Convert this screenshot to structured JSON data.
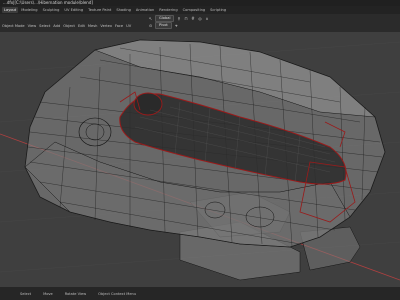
{
  "window": {
    "title": "...dfx|[C:\\Users\\...\\Hibernation module\\blend]"
  },
  "workspace_tabs": [
    {
      "label": "Layout",
      "active": true
    },
    {
      "label": "Modeling",
      "active": false
    },
    {
      "label": "Sculpting",
      "active": false
    },
    {
      "label": "UV Editing",
      "active": false
    },
    {
      "label": "Texture Paint",
      "active": false
    },
    {
      "label": "Shading",
      "active": false
    },
    {
      "label": "Animation",
      "active": false
    },
    {
      "label": "Rendering",
      "active": false
    },
    {
      "label": "Compositing",
      "active": false
    },
    {
      "label": "Scripting",
      "active": false
    }
  ],
  "toolbar": {
    "orientation": "Global",
    "snap_mode": "Pivot",
    "header_menus": [
      "Object Mode",
      "View",
      "Select",
      "Add",
      "Object",
      "Edit",
      "Mesh",
      "Vertex",
      "Face",
      "UV"
    ]
  },
  "statusbar": {
    "items": [
      "Select",
      "Move",
      "Rotate View",
      "Object Context Menu"
    ]
  },
  "colors": {
    "wire": "#111111",
    "selected": "#9a1a1a",
    "axis_x": "#b04040",
    "accent": "#4772b3"
  }
}
